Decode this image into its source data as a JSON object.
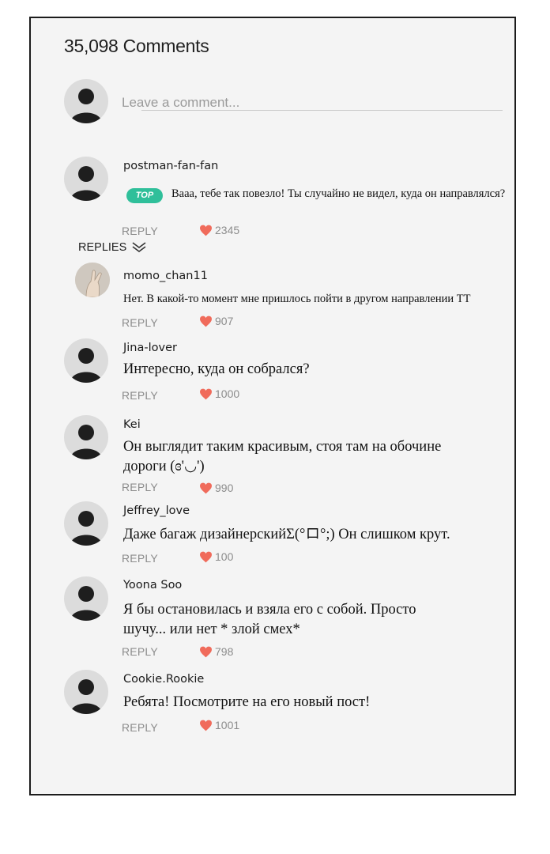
{
  "header": {
    "title": "35,098 Comments"
  },
  "composer": {
    "placeholder": "Leave a comment..."
  },
  "reply_label": "REPLY",
  "replies_label": "REPLIES",
  "top_badge": "TOP",
  "colors": {
    "heart": "#f06b5b",
    "badge": "#2fbf9a",
    "muted": "#8c8c8c"
  },
  "icons": {
    "avatar": "user-silhouette-icon",
    "like": "heart-icon",
    "expand": "double-chevron-down-icon"
  },
  "comments": [
    {
      "user": "postman-fan-fan",
      "text": "Вааа, тебе так повезло! Ты случайно не видел, куда он направлялся?",
      "likes": "2345",
      "top": true
    },
    {
      "user": "momo_chan11",
      "text": "Нет. В какой-то момент мне пришлось пойти в другом направлении TT",
      "likes": "907",
      "is_reply": true
    },
    {
      "user": "Jina-lover",
      "text": "Интересно, куда он собрался?",
      "likes": "1000"
    },
    {
      "user": "Kei",
      "text_lines": [
        "Он выглядит таким красивым, стоя там на обочине",
        "дороги (ɞ'◡')"
      ],
      "likes": "990"
    },
    {
      "user": "Jeffrey_love",
      "text": "Даже багаж дизайнерскийΣ(°ロ°;) Он слишком крут.",
      "likes": "100"
    },
    {
      "user": "Yoona Soo",
      "text_lines": [
        "Я бы остановилась и взяла его с собой. Просто",
        "шучу... или нет * злой смех*"
      ],
      "likes": "798"
    },
    {
      "user": "Cookie.Rookie",
      "text": "Ребята! Посмотрите на его новый пост!",
      "likes": "1001"
    }
  ]
}
